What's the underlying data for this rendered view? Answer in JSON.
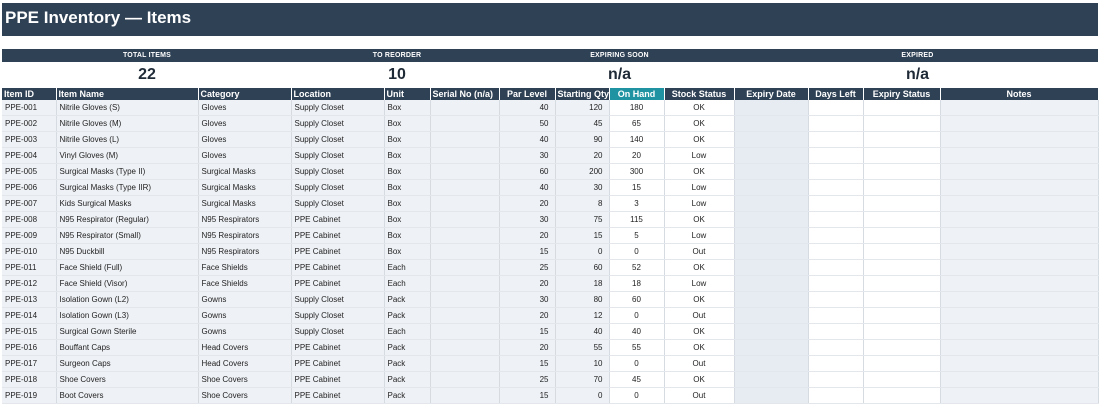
{
  "title": "PPE Inventory — Items",
  "kpis": [
    {
      "label": "TOTAL ITEMS",
      "value": "22"
    },
    {
      "label": "TO REORDER",
      "value": "10"
    },
    {
      "label": "EXPIRING SOON",
      "value": "n/a"
    },
    {
      "label": "EXPIRED",
      "value": "n/a"
    }
  ],
  "columns": [
    "Item ID",
    "Item Name",
    "Category",
    "Location",
    "Unit",
    "Serial No (n/a)",
    "Par Level",
    "Starting Qty",
    "On Hand",
    "Stock Status",
    "Expiry Date",
    "Days Left",
    "Expiry Status",
    "Notes"
  ],
  "rows": [
    {
      "id": "PPE-001",
      "name": "Nitrile Gloves (S)",
      "category": "Gloves",
      "location": "Supply Closet",
      "unit": "Box",
      "par": "40",
      "start": "120",
      "onhand": "180",
      "status": "OK"
    },
    {
      "id": "PPE-002",
      "name": "Nitrile Gloves (M)",
      "category": "Gloves",
      "location": "Supply Closet",
      "unit": "Box",
      "par": "50",
      "start": "45",
      "onhand": "65",
      "status": "OK"
    },
    {
      "id": "PPE-003",
      "name": "Nitrile Gloves (L)",
      "category": "Gloves",
      "location": "Supply Closet",
      "unit": "Box",
      "par": "40",
      "start": "90",
      "onhand": "140",
      "status": "OK"
    },
    {
      "id": "PPE-004",
      "name": "Vinyl Gloves (M)",
      "category": "Gloves",
      "location": "Supply Closet",
      "unit": "Box",
      "par": "30",
      "start": "20",
      "onhand": "20",
      "status": "Low"
    },
    {
      "id": "PPE-005",
      "name": "Surgical Masks (Type II)",
      "category": "Surgical Masks",
      "location": "Supply Closet",
      "unit": "Box",
      "par": "60",
      "start": "200",
      "onhand": "300",
      "status": "OK"
    },
    {
      "id": "PPE-006",
      "name": "Surgical Masks (Type IIR)",
      "category": "Surgical Masks",
      "location": "Supply Closet",
      "unit": "Box",
      "par": "40",
      "start": "30",
      "onhand": "15",
      "status": "Low"
    },
    {
      "id": "PPE-007",
      "name": "Kids Surgical Masks",
      "category": "Surgical Masks",
      "location": "Supply Closet",
      "unit": "Box",
      "par": "20",
      "start": "8",
      "onhand": "3",
      "status": "Low"
    },
    {
      "id": "PPE-008",
      "name": "N95 Respirator (Regular)",
      "category": "N95 Respirators",
      "location": "PPE Cabinet",
      "unit": "Box",
      "par": "30",
      "start": "75",
      "onhand": "115",
      "status": "OK"
    },
    {
      "id": "PPE-009",
      "name": "N95 Respirator (Small)",
      "category": "N95 Respirators",
      "location": "PPE Cabinet",
      "unit": "Box",
      "par": "20",
      "start": "15",
      "onhand": "5",
      "status": "Low"
    },
    {
      "id": "PPE-010",
      "name": "N95 Duckbill",
      "category": "N95 Respirators",
      "location": "PPE Cabinet",
      "unit": "Box",
      "par": "15",
      "start": "0",
      "onhand": "0",
      "status": "Out"
    },
    {
      "id": "PPE-011",
      "name": "Face Shield (Full)",
      "category": "Face Shields",
      "location": "PPE Cabinet",
      "unit": "Each",
      "par": "25",
      "start": "60",
      "onhand": "52",
      "status": "OK"
    },
    {
      "id": "PPE-012",
      "name": "Face Shield (Visor)",
      "category": "Face Shields",
      "location": "PPE Cabinet",
      "unit": "Each",
      "par": "20",
      "start": "18",
      "onhand": "18",
      "status": "Low"
    },
    {
      "id": "PPE-013",
      "name": "Isolation Gown (L2)",
      "category": "Gowns",
      "location": "Supply Closet",
      "unit": "Pack",
      "par": "30",
      "start": "80",
      "onhand": "60",
      "status": "OK"
    },
    {
      "id": "PPE-014",
      "name": "Isolation Gown (L3)",
      "category": "Gowns",
      "location": "Supply Closet",
      "unit": "Pack",
      "par": "20",
      "start": "12",
      "onhand": "0",
      "status": "Out"
    },
    {
      "id": "PPE-015",
      "name": "Surgical Gown Sterile",
      "category": "Gowns",
      "location": "Supply Closet",
      "unit": "Each",
      "par": "15",
      "start": "40",
      "onhand": "40",
      "status": "OK"
    },
    {
      "id": "PPE-016",
      "name": "Bouffant Caps",
      "category": "Head Covers",
      "location": "PPE Cabinet",
      "unit": "Pack",
      "par": "20",
      "start": "55",
      "onhand": "55",
      "status": "OK"
    },
    {
      "id": "PPE-017",
      "name": "Surgeon Caps",
      "category": "Head Covers",
      "location": "PPE Cabinet",
      "unit": "Pack",
      "par": "15",
      "start": "10",
      "onhand": "0",
      "status": "Out"
    },
    {
      "id": "PPE-018",
      "name": "Shoe Covers",
      "category": "Shoe Covers",
      "location": "PPE Cabinet",
      "unit": "Pack",
      "par": "25",
      "start": "70",
      "onhand": "45",
      "status": "OK"
    },
    {
      "id": "PPE-019",
      "name": "Boot Covers",
      "category": "Shoe Covers",
      "location": "PPE Cabinet",
      "unit": "Pack",
      "par": "15",
      "start": "0",
      "onhand": "0",
      "status": "Out"
    }
  ]
}
